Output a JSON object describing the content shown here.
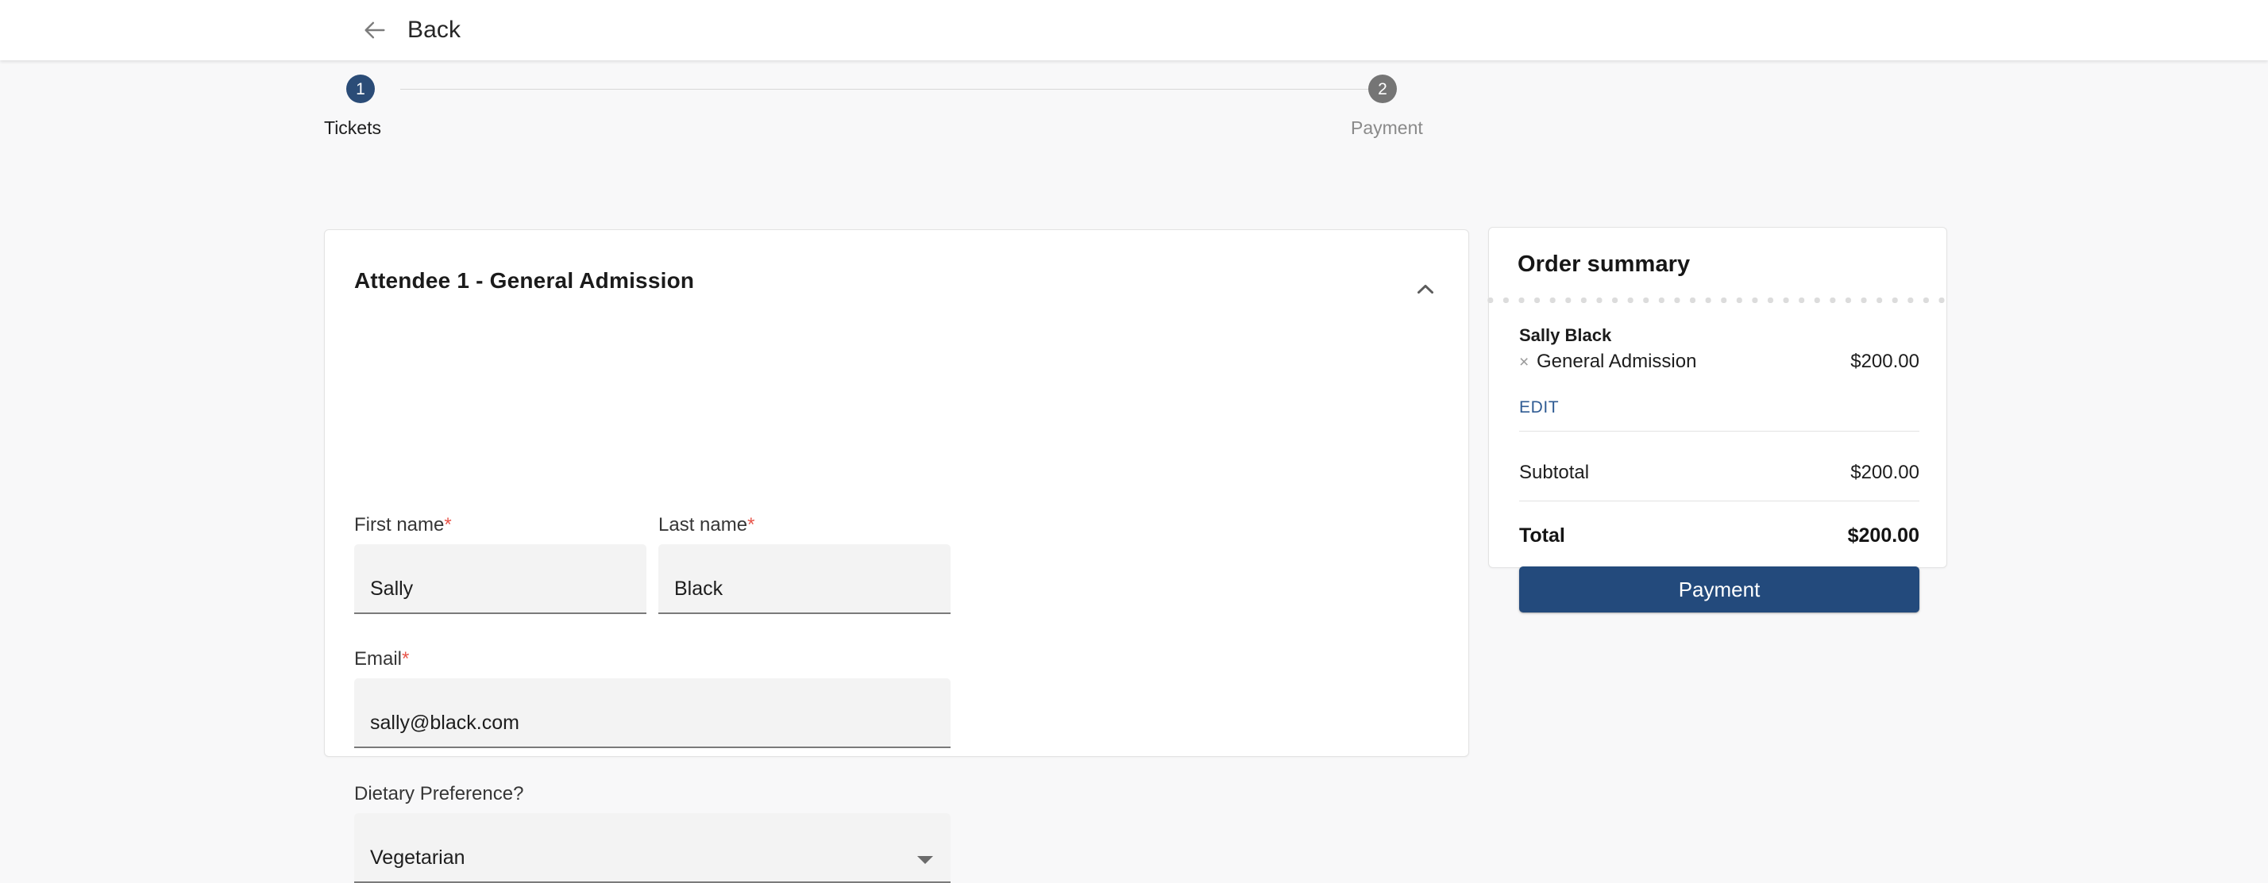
{
  "header": {
    "back_label": "Back",
    "back_icon": "arrow-left-icon"
  },
  "stepper": {
    "steps": [
      {
        "number": "1",
        "label": "Tickets",
        "state": "active",
        "color": "#2b4c77"
      },
      {
        "number": "2",
        "label": "Payment",
        "state": "inactive",
        "color": "#757575"
      }
    ]
  },
  "attendee_form": {
    "title": "Attendee 1  -  General Admission",
    "collapse_icon": "chevron-up-icon",
    "fields": [
      {
        "label": "First name",
        "required": true,
        "required_mark": "*",
        "value": "Sally",
        "type": "text"
      },
      {
        "label": "Last name",
        "required": true,
        "required_mark": "*",
        "value": "Black",
        "type": "text"
      },
      {
        "label": "Email",
        "required": true,
        "required_mark": "*",
        "value": "sally@black.com",
        "type": "email"
      },
      {
        "label": "Dietary Preference?",
        "required": false,
        "required_mark": "",
        "value": "Vegetarian",
        "type": "select",
        "arrow_icon": "caret-down-icon"
      }
    ]
  },
  "order_summary": {
    "title": "Order summary",
    "buyer_name": "Sally Black",
    "line_items": [
      {
        "qty_symbol": "×",
        "name": "General Admission",
        "price": "$200.00"
      }
    ],
    "edit_label": "EDIT",
    "subtotal_label": "Subtotal",
    "subtotal_value": "$200.00",
    "total_label": "Total",
    "total_value": "$200.00",
    "payment_button_label": "Payment",
    "accent_color": "#234a7c",
    "link_color": "#2f5b93"
  }
}
